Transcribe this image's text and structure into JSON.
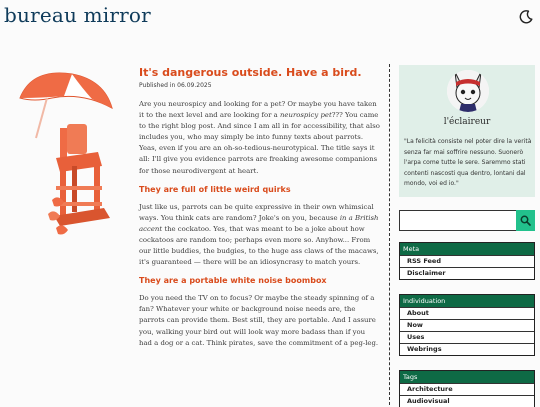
{
  "site": {
    "title": "bureau mirror"
  },
  "post": {
    "title": "It's dangerous outside. Have a bird.",
    "published": "Published in 06.09.2025",
    "intro": {
      "before": "Are you neurospicy and looking for a pet? Or maybe you have taken it to the next level and are looking for a ",
      "em": "neurospicy pet",
      "after": "??? You came to the right blog post. And since I am all in for accessibility, that also includes you, who may simply be into funny texts about parrots. Yeas, even if you are an oh-so-tedious-neurotypical. The title says it all: I'll give you evidence parrots are freaking awesome companions for those neurodivergent at heart."
    },
    "section1": {
      "heading": "They are full of little weird quirks",
      "before": "Just like us, parrots can be quite expressive in their own whimsical ways. You think cats are random? Joke's on you, because ",
      "em": "in a British accent",
      "after": " the cockatoo. Yes, that was meant to be a joke about how cockatoos are random too; perhaps even more so. Anyhow... From our little buddies, the budgies, to the huge ass claws of the macaws, it's guaranteed — there will be an idiosyncrasy to match yours."
    },
    "section2": {
      "heading": "They are a portable white noise boombox",
      "text": "Do you need the TV on to focus? Or maybe the steady spinning of a fan? Whatever your white or background noise needs are, the parrots can provide them. Best still, they are portable. And I assure you, walking your bird out will look way more badass than if you had a dog or a cat. Think pirates, save the commitment of a peg-leg."
    }
  },
  "profile": {
    "name": "l'éclaireur",
    "quote": "\"La felicità consiste nel poter dire la verità senza far mai soffrire nessuno. Suonerò l'arpa come tutte le sere. Saremmo stati contenti nascosti qua dentro, lontani dal mondo, voi ed io.\""
  },
  "search": {
    "placeholder": "",
    "value": ""
  },
  "meta": {
    "title": "Meta",
    "items": [
      "RSS Feed",
      "Disclaimer"
    ]
  },
  "individuation": {
    "title": "Individuation",
    "items": [
      "About",
      "Now",
      "Uses",
      "Webrings"
    ]
  },
  "tags": {
    "title": "Tags",
    "items": [
      "Architecture",
      "Audiovisual"
    ]
  },
  "colors": {
    "accent": "#d94b1c",
    "brand": "#0f3b5a",
    "widget_header": "#0e6a45",
    "search_button": "#22c18c",
    "profile_bg": "#e0efe8"
  },
  "icons": {
    "theme": "moon-icon",
    "search": "search-icon"
  }
}
